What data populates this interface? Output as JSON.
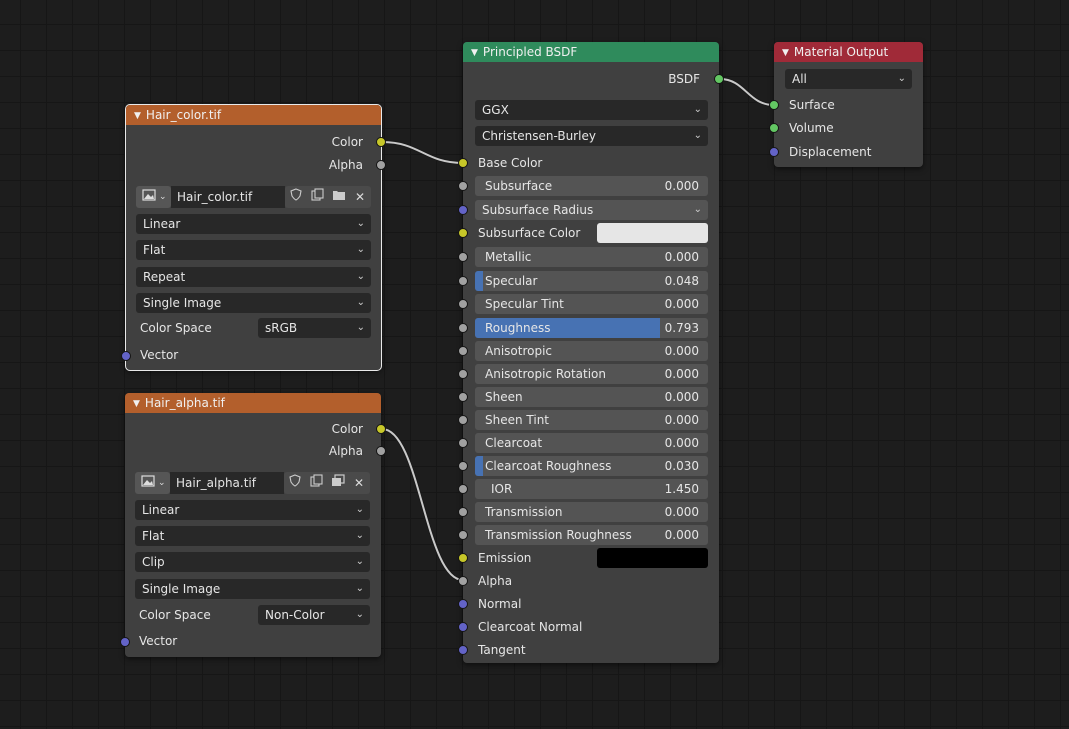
{
  "colors": {
    "texture_header": "#b35f2c",
    "shader_header": "#2f8b5c",
    "output_header": "#a02a38",
    "socket_color": "#c7c729",
    "socket_float": "#a1a1a1",
    "socket_shader": "#63c763",
    "socket_vector": "#6363c7",
    "slider_fill": "#4772b3"
  },
  "hair_color_node": {
    "title": "Hair_color.tif",
    "outputs": {
      "color": "Color",
      "alpha": "Alpha"
    },
    "image_name": "Hair_color.tif",
    "interpolation": "Linear",
    "projection": "Flat",
    "extension": "Repeat",
    "source": "Single Image",
    "color_space_label": "Color Space",
    "color_space": "sRGB",
    "vector_label": "Vector",
    "icons": [
      "image-browse-icon",
      "fake-user-shield-icon",
      "duplicate-icon",
      "open-folder-icon",
      "unlink-x-icon"
    ]
  },
  "hair_alpha_node": {
    "title": "Hair_alpha.tif",
    "outputs": {
      "color": "Color",
      "alpha": "Alpha"
    },
    "image_name": "Hair_alpha.tif",
    "interpolation": "Linear",
    "projection": "Flat",
    "extension": "Clip",
    "source": "Single Image",
    "color_space_label": "Color Space",
    "color_space": "Non-Color",
    "vector_label": "Vector",
    "icons": [
      "image-browse-icon",
      "fake-user-shield-icon",
      "duplicate-icon",
      "reload-icon",
      "unlink-x-icon"
    ]
  },
  "bsdf_node": {
    "title": "Principled BSDF",
    "output_label": "BSDF",
    "distribution": "GGX",
    "subsurface_method": "Christensen-Burley",
    "base_color_label": "Base Color",
    "subsurface": {
      "label": "Subsurface",
      "value": "0.000",
      "fraction": 0
    },
    "subsurface_radius_label": "Subsurface Radius",
    "subsurface_color_label": "Subsurface Color",
    "subsurface_color": "#e6e6e6",
    "metallic": {
      "label": "Metallic",
      "value": "0.000",
      "fraction": 0
    },
    "specular": {
      "label": "Specular",
      "value": "0.048",
      "fraction": 0.048
    },
    "specular_tint": {
      "label": "Specular Tint",
      "value": "0.000",
      "fraction": 0
    },
    "roughness": {
      "label": "Roughness",
      "value": "0.793",
      "fraction": 0.793
    },
    "anisotropic": {
      "label": "Anisotropic",
      "value": "0.000",
      "fraction": 0
    },
    "anisotropic_rotation": {
      "label": "Anisotropic Rotation",
      "value": "0.000",
      "fraction": 0
    },
    "sheen": {
      "label": "Sheen",
      "value": "0.000",
      "fraction": 0
    },
    "sheen_tint": {
      "label": "Sheen Tint",
      "value": "0.000",
      "fraction": 0
    },
    "clearcoat": {
      "label": "Clearcoat",
      "value": "0.000",
      "fraction": 0
    },
    "clearcoat_roughness": {
      "label": "Clearcoat Roughness",
      "value": "0.030",
      "fraction": 0.03
    },
    "ior": {
      "label": "IOR",
      "value": "1.450"
    },
    "transmission": {
      "label": "Transmission",
      "value": "0.000",
      "fraction": 0
    },
    "transmission_roughness": {
      "label": "Transmission Roughness",
      "value": "0.000",
      "fraction": 0
    },
    "emission_label": "Emission",
    "emission_color": "#000000",
    "alpha_label": "Alpha",
    "normal_label": "Normal",
    "clearcoat_normal_label": "Clearcoat Normal",
    "tangent_label": "Tangent"
  },
  "output_node": {
    "title": "Material Output",
    "target": "All",
    "surface_label": "Surface",
    "volume_label": "Volume",
    "displacement_label": "Displacement"
  }
}
